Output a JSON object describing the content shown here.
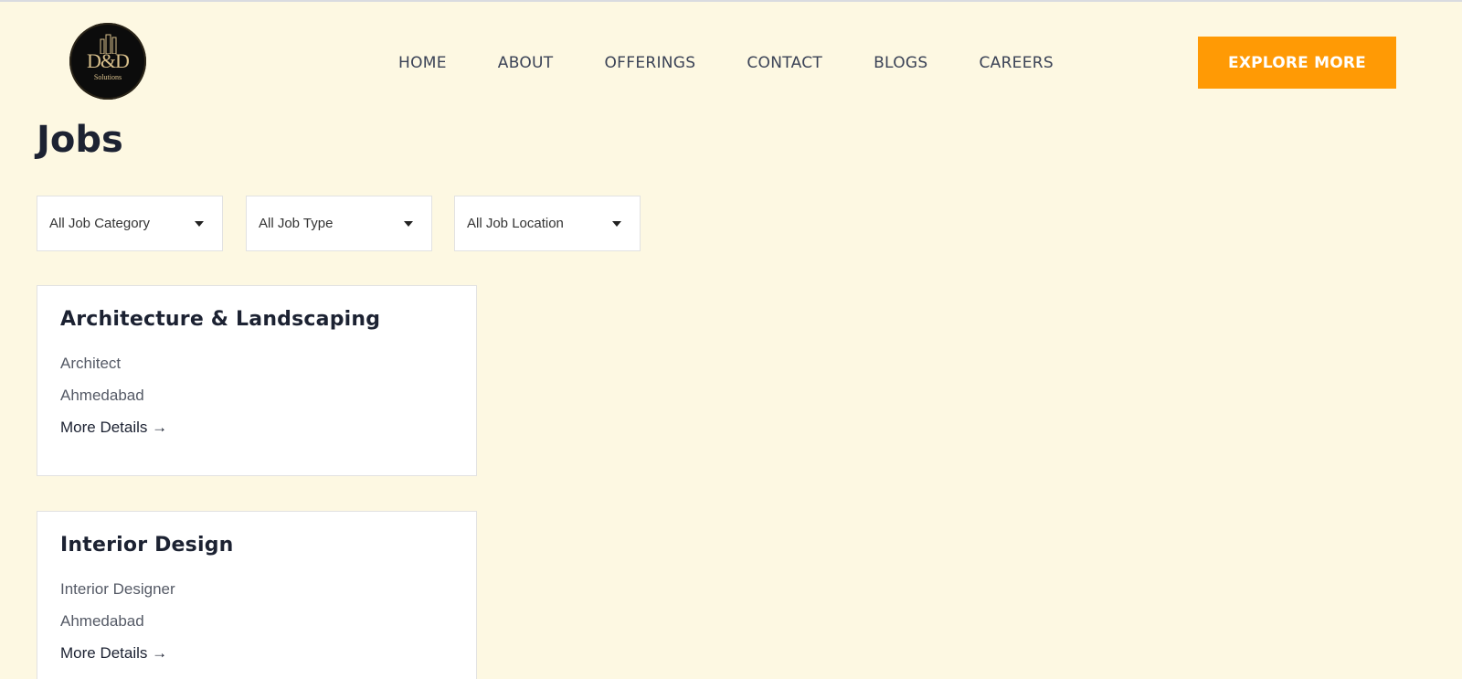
{
  "header": {
    "logo_text": "D&D",
    "logo_sub": "Solutions",
    "nav": [
      {
        "label": "HOME"
      },
      {
        "label": "ABOUT"
      },
      {
        "label": "OFFERINGS"
      },
      {
        "label": "CONTACT"
      },
      {
        "label": "BLOGS"
      },
      {
        "label": "CAREERS"
      }
    ],
    "cta_label": "EXPLORE MORE"
  },
  "page": {
    "title": "Jobs"
  },
  "filters": [
    {
      "label": "All Job Category"
    },
    {
      "label": "All Job Type"
    },
    {
      "label": "All Job Location"
    }
  ],
  "jobs": [
    {
      "category": "Architecture & Landscaping",
      "title": "Architect",
      "location": "Ahmedabad",
      "link": "More Details →"
    },
    {
      "category": "Interior Design",
      "title": "Interior Designer",
      "location": "Ahmedabad",
      "link": "More Details →"
    }
  ],
  "colors": {
    "background": "#fdf8e2",
    "accent": "#ff9a05",
    "text": "#1c2232"
  }
}
